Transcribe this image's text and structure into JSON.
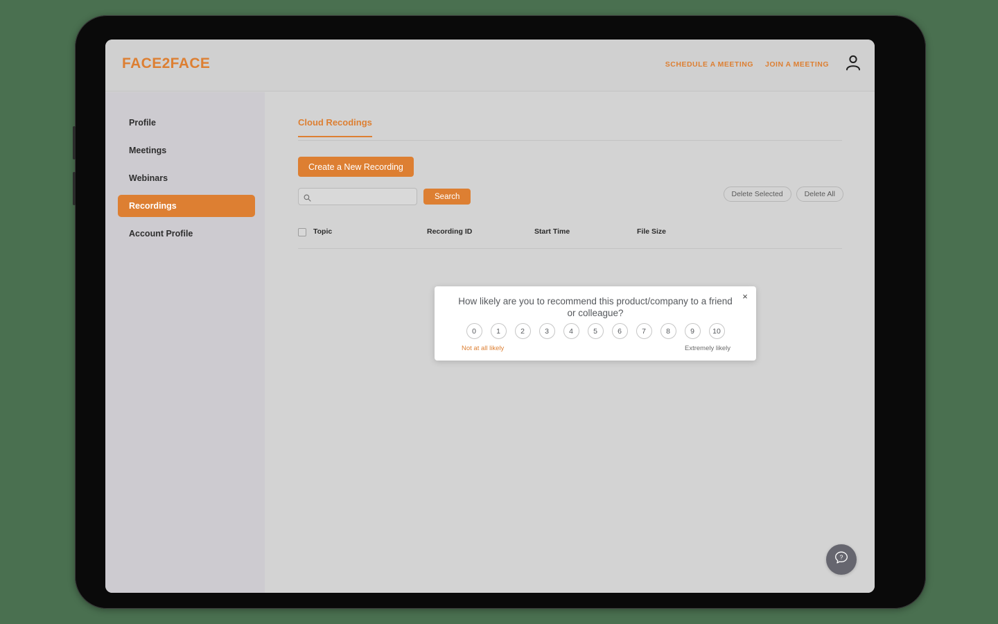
{
  "app": {
    "brand": "FACE2FACE"
  },
  "header": {
    "links": [
      {
        "label": "SCHEDULE A MEETING",
        "name": "schedule-a-meeting-link"
      },
      {
        "label": "JOIN A MEETING",
        "name": "join-a-meeting-link"
      }
    ],
    "avatar_icon": "user-avatar-icon"
  },
  "sidebar": {
    "items": [
      {
        "label": "Profile",
        "active": false
      },
      {
        "label": "Meetings",
        "active": false
      },
      {
        "label": "Webinars",
        "active": false
      },
      {
        "label": "Recordings",
        "active": true
      },
      {
        "label": "Account Profile",
        "active": false
      }
    ]
  },
  "main": {
    "tab_label": "Cloud Recodings",
    "create_button": "Create a New Recording",
    "search": {
      "value": "",
      "placeholder": "",
      "icon": "search-icon",
      "button_label": "Search"
    },
    "delete_selected_label": "Delete Selected",
    "delete_all_label": "Delete All",
    "table": {
      "select_all_checkbox": "select-all-checkbox",
      "columns": [
        "Topic",
        "Recording ID",
        "Start Time",
        "File Size"
      ],
      "rows": []
    }
  },
  "modal": {
    "question": "How likely are you to recommend this product/company to a friend or colleague?",
    "scores": [
      "0",
      "1",
      "2",
      "3",
      "4",
      "5",
      "6",
      "7",
      "8",
      "9",
      "10"
    ],
    "anchor_low": "Not at all likely",
    "anchor_high": "Extremely likely",
    "close_icon": "close-icon",
    "close_label": "×"
  },
  "help": {
    "icon": "help-question-icon"
  },
  "colors": {
    "accent": "#dd7f32",
    "background": "#4a7050",
    "sidebar": "#cdcbd0",
    "content": "#d3d3d3",
    "header": "#d0d0d0",
    "fab": "#66666f"
  }
}
